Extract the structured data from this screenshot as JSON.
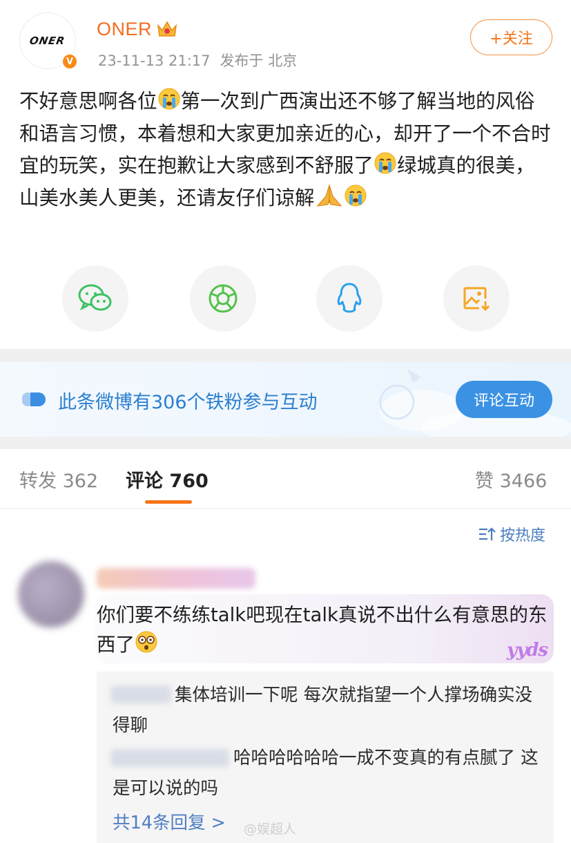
{
  "author": {
    "name": "ONER",
    "avatar_text": "ONER",
    "verified_mark": "V",
    "date": "23-11-13 21:17",
    "location": "发布于 北京",
    "follow_label": "+关注"
  },
  "post": {
    "p1": "不好意思啊各位",
    "p2": "第一次到广西演出还不够了解当地的风俗和语言习惯，本着想和大家更加亲近的心，却开了一个不合时宜的玩笑，实在抱歉让大家感到不舒服了",
    "p3": "绿城真的很美，山美水美人更美，还请友仔们谅解"
  },
  "share_icons": [
    "wechat-icon",
    "moments-icon",
    "qq-icon",
    "save-image-icon"
  ],
  "banner": {
    "text": "此条微博有306个铁粉参与互动",
    "button": "评论互动"
  },
  "tabs": {
    "repost_label": "转发",
    "repost_count": "362",
    "comment_label": "评论",
    "comment_count": "760",
    "like_label": "赞",
    "like_count": "3466"
  },
  "sort_label": "按热度",
  "comment": {
    "text": "你们要不练练talk吧现在talk真说不出什么有意思的东西了",
    "sticker": "yyds",
    "replies": [
      {
        "text": "集体培训一下呢 每次就指望一个人撑场确实没得聊"
      },
      {
        "text": "哈哈哈哈哈哈一成不变真的有点腻了 这是可以说的吗"
      }
    ],
    "more_replies": "共14条回复 >"
  },
  "watermark": "@娱超人",
  "colors": {
    "brand_orange": "#f57418",
    "link_blue": "#4a7dc0",
    "banner_blue": "#3b92e4"
  }
}
